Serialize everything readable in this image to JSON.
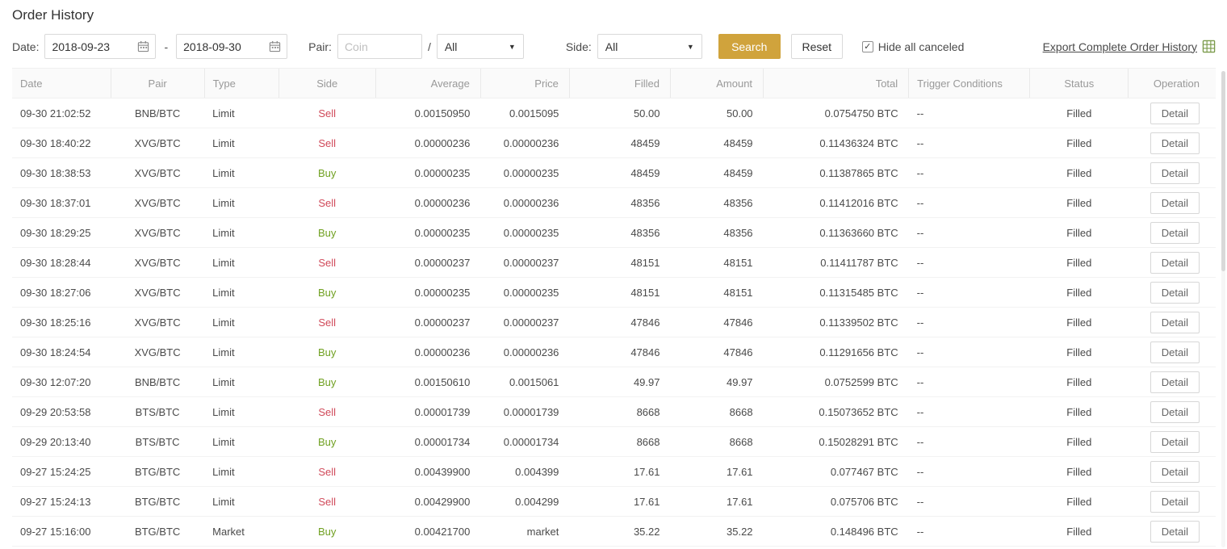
{
  "page": {
    "title": "Order History"
  },
  "icons": {
    "dropdown_caret": "▼",
    "checkbox_check": "✓"
  },
  "colors": {
    "accent": "#d0a33c",
    "buy": "#70a021",
    "sell": "#d04a5a"
  },
  "filters": {
    "date_label": "Date:",
    "date_from": "2018-09-23",
    "date_separator": "-",
    "date_to": "2018-09-30",
    "pair_label": "Pair:",
    "coin_placeholder": "Coin",
    "pair_divider": "/",
    "quote_value": "All",
    "side_label": "Side:",
    "side_value": "All",
    "search_label": "Search",
    "reset_label": "Reset",
    "hide_canceled_checked": true,
    "hide_canceled_label": "Hide all canceled",
    "export_label": "Export Complete Order History"
  },
  "table": {
    "columns": [
      "Date",
      "Pair",
      "Type",
      "Side",
      "Average",
      "Price",
      "Filled",
      "Amount",
      "Total",
      "Trigger Conditions",
      "Status",
      "Operation"
    ],
    "detail_label": "Detail",
    "rows": [
      {
        "date": "09-30 21:02:52",
        "pair": "BNB/BTC",
        "type": "Limit",
        "side": "Sell",
        "average": "0.00150950",
        "price": "0.0015095",
        "filled": "50.00",
        "amount": "50.00",
        "total": "0.0754750 BTC",
        "trigger": "--",
        "status": "Filled"
      },
      {
        "date": "09-30 18:40:22",
        "pair": "XVG/BTC",
        "type": "Limit",
        "side": "Sell",
        "average": "0.00000236",
        "price": "0.00000236",
        "filled": "48459",
        "amount": "48459",
        "total": "0.11436324 BTC",
        "trigger": "--",
        "status": "Filled"
      },
      {
        "date": "09-30 18:38:53",
        "pair": "XVG/BTC",
        "type": "Limit",
        "side": "Buy",
        "average": "0.00000235",
        "price": "0.00000235",
        "filled": "48459",
        "amount": "48459",
        "total": "0.11387865 BTC",
        "trigger": "--",
        "status": "Filled"
      },
      {
        "date": "09-30 18:37:01",
        "pair": "XVG/BTC",
        "type": "Limit",
        "side": "Sell",
        "average": "0.00000236",
        "price": "0.00000236",
        "filled": "48356",
        "amount": "48356",
        "total": "0.11412016 BTC",
        "trigger": "--",
        "status": "Filled"
      },
      {
        "date": "09-30 18:29:25",
        "pair": "XVG/BTC",
        "type": "Limit",
        "side": "Buy",
        "average": "0.00000235",
        "price": "0.00000235",
        "filled": "48356",
        "amount": "48356",
        "total": "0.11363660 BTC",
        "trigger": "--",
        "status": "Filled"
      },
      {
        "date": "09-30 18:28:44",
        "pair": "XVG/BTC",
        "type": "Limit",
        "side": "Sell",
        "average": "0.00000237",
        "price": "0.00000237",
        "filled": "48151",
        "amount": "48151",
        "total": "0.11411787 BTC",
        "trigger": "--",
        "status": "Filled"
      },
      {
        "date": "09-30 18:27:06",
        "pair": "XVG/BTC",
        "type": "Limit",
        "side": "Buy",
        "average": "0.00000235",
        "price": "0.00000235",
        "filled": "48151",
        "amount": "48151",
        "total": "0.11315485 BTC",
        "trigger": "--",
        "status": "Filled"
      },
      {
        "date": "09-30 18:25:16",
        "pair": "XVG/BTC",
        "type": "Limit",
        "side": "Sell",
        "average": "0.00000237",
        "price": "0.00000237",
        "filled": "47846",
        "amount": "47846",
        "total": "0.11339502 BTC",
        "trigger": "--",
        "status": "Filled"
      },
      {
        "date": "09-30 18:24:54",
        "pair": "XVG/BTC",
        "type": "Limit",
        "side": "Buy",
        "average": "0.00000236",
        "price": "0.00000236",
        "filled": "47846",
        "amount": "47846",
        "total": "0.11291656 BTC",
        "trigger": "--",
        "status": "Filled"
      },
      {
        "date": "09-30 12:07:20",
        "pair": "BNB/BTC",
        "type": "Limit",
        "side": "Buy",
        "average": "0.00150610",
        "price": "0.0015061",
        "filled": "49.97",
        "amount": "49.97",
        "total": "0.0752599 BTC",
        "trigger": "--",
        "status": "Filled"
      },
      {
        "date": "09-29 20:53:58",
        "pair": "BTS/BTC",
        "type": "Limit",
        "side": "Sell",
        "average": "0.00001739",
        "price": "0.00001739",
        "filled": "8668",
        "amount": "8668",
        "total": "0.15073652 BTC",
        "trigger": "--",
        "status": "Filled"
      },
      {
        "date": "09-29 20:13:40",
        "pair": "BTS/BTC",
        "type": "Limit",
        "side": "Buy",
        "average": "0.00001734",
        "price": "0.00001734",
        "filled": "8668",
        "amount": "8668",
        "total": "0.15028291 BTC",
        "trigger": "--",
        "status": "Filled"
      },
      {
        "date": "09-27 15:24:25",
        "pair": "BTG/BTC",
        "type": "Limit",
        "side": "Sell",
        "average": "0.00439900",
        "price": "0.004399",
        "filled": "17.61",
        "amount": "17.61",
        "total": "0.077467 BTC",
        "trigger": "--",
        "status": "Filled"
      },
      {
        "date": "09-27 15:24:13",
        "pair": "BTG/BTC",
        "type": "Limit",
        "side": "Sell",
        "average": "0.00429900",
        "price": "0.004299",
        "filled": "17.61",
        "amount": "17.61",
        "total": "0.075706 BTC",
        "trigger": "--",
        "status": "Filled"
      },
      {
        "date": "09-27 15:16:00",
        "pair": "BTG/BTC",
        "type": "Market",
        "side": "Buy",
        "average": "0.00421700",
        "price": "market",
        "filled": "35.22",
        "amount": "35.22",
        "total": "0.148496 BTC",
        "trigger": "--",
        "status": "Filled"
      }
    ]
  }
}
